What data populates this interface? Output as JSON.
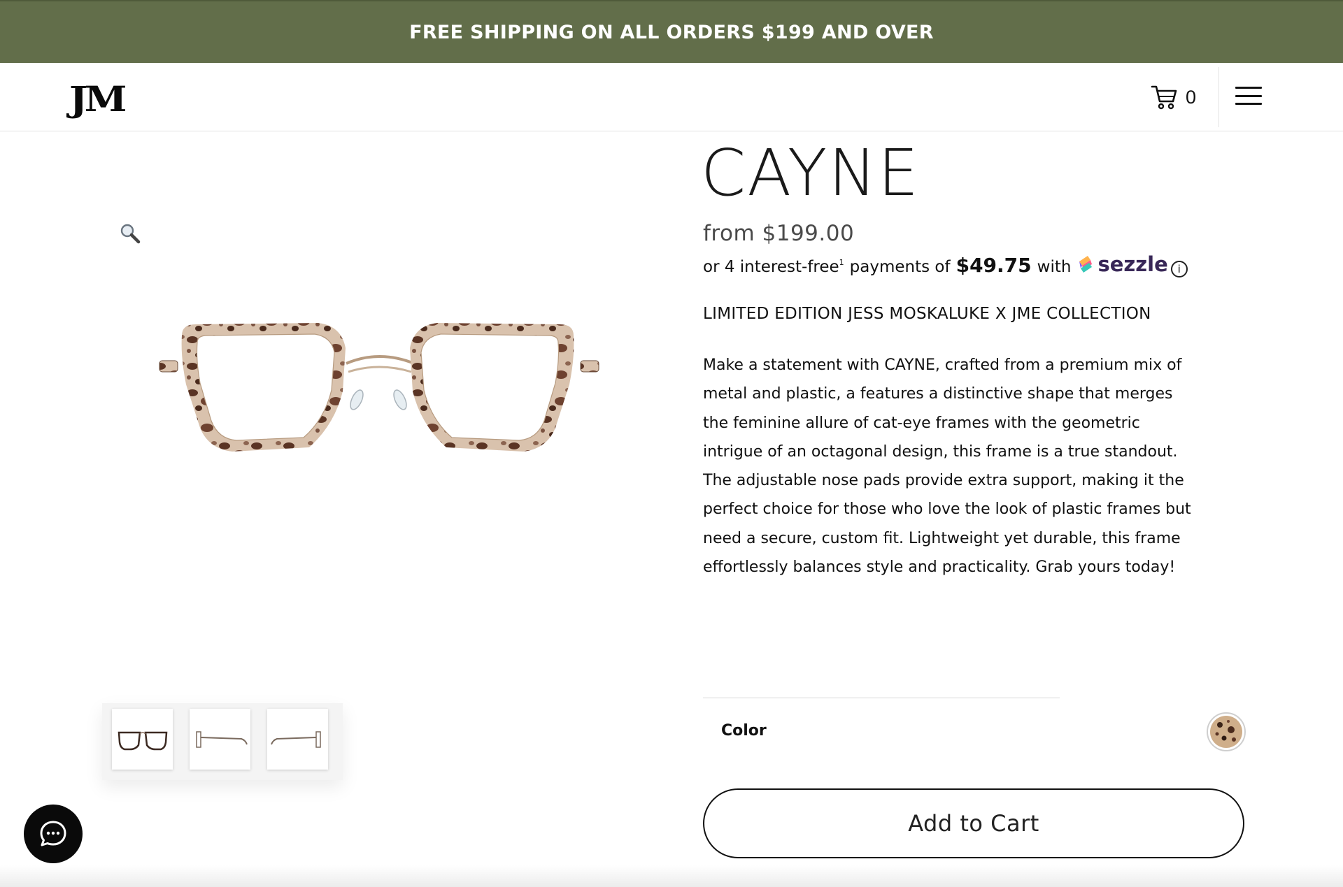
{
  "promo": {
    "text": "FREE SHIPPING ON ALL ORDERS $199 AND OVER"
  },
  "header": {
    "logo": "JM",
    "cart_count": "0",
    "icons": {
      "cart": "cart-icon",
      "menu": "hamburger-menu-icon"
    }
  },
  "gallery": {
    "zoom_icon": "magnifier-icon",
    "thumbnails": [
      "front-view",
      "side-view",
      "temple-view"
    ]
  },
  "product": {
    "title": "CAYNE",
    "price": "from $199.00",
    "installments": {
      "prefix": "or 4 interest-free",
      "footnote": "1",
      "middle": "payments of",
      "amount": "$49.75",
      "with": "with",
      "provider": "sezzle",
      "info": "i"
    },
    "collection": "LIMITED EDITION JESS MOSKALUKE X JME COLLECTION",
    "description_lines": [
      "Make a statement with CAYNE, crafted from a premium mix of",
      "metal and plastic, a features a distinctive shape that merges",
      "the feminine allure of cat-eye frames with the geometric",
      "intrigue of an octagonal design, this frame is a true standout.",
      "The adjustable nose pads provide extra support, making it the",
      "perfect choice for those who love the look of plastic frames but",
      "need a secure, custom fit. Lightweight yet durable, this frame",
      "effortlessly balances style and practicality. Grab yours today!"
    ],
    "color_label": "Color",
    "color_swatch": "tortoise",
    "add_to_cart": "Add to Cart"
  },
  "chat": {
    "icon": "chat-bubble-icon"
  },
  "colors": {
    "promo_bg": "#626e4a",
    "tortoise_light": "#d9c2ad",
    "tortoise_dark": "#5a3424",
    "sezzle_purple": "#382757"
  }
}
